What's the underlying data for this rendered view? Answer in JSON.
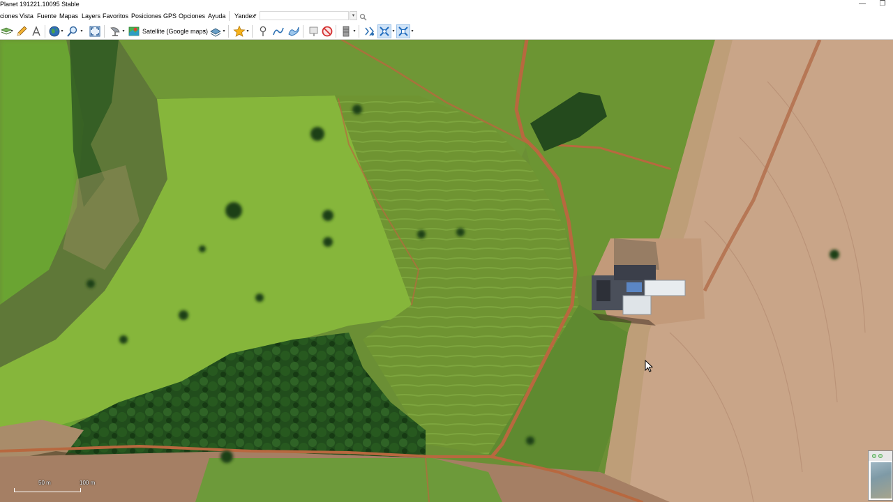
{
  "window": {
    "title": "Planet 191221.10095 Stable",
    "minimize_glyph": "—",
    "restore_glyph": "❐"
  },
  "menu": {
    "items": [
      "ciones",
      "Vista",
      "Fuente",
      "Mapas",
      "Layers",
      "Favoritos",
      "Posiciones",
      "GPS",
      "Opciones",
      "Ayuda"
    ],
    "provider": "Yandex",
    "search_value": ""
  },
  "toolbar": {
    "map_type_label": "Satellite (Google maps)",
    "icons": [
      "layers-icon",
      "pencil-icon",
      "text-tool-icon",
      "globe-icon",
      "zoom-icon",
      "fullscreen-icon",
      "satellite-dish-icon",
      "map-source-icon",
      "stack-icon",
      "favorite-star-icon",
      "placemark-icon",
      "path-icon",
      "polygon-icon",
      "marks-icon",
      "stop-icon",
      "cache-icon",
      "gps-track-icon",
      "gps-follow-icon",
      "gps-center-icon"
    ],
    "active": [
      "gps-follow-icon",
      "gps-center-icon"
    ]
  },
  "map": {
    "scale_labels": [
      "50 m",
      "100 m"
    ],
    "colors": {
      "pasture": "#7ea53a",
      "field": "#6f9432",
      "bare_soil": "#c9a486",
      "forest": "#1f4d1a",
      "dirt_road": "#b8683f"
    }
  }
}
